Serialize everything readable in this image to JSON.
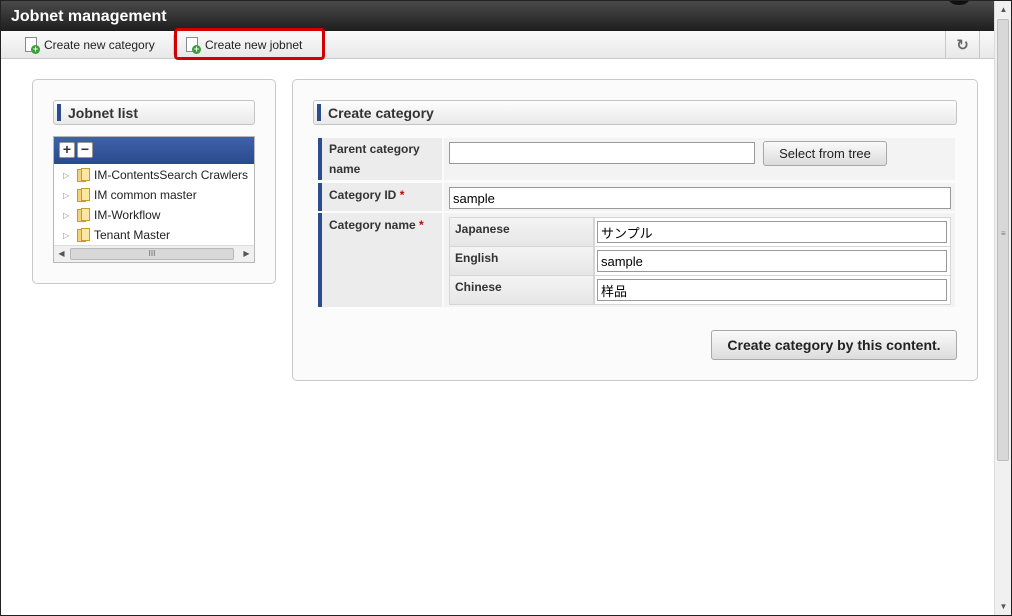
{
  "window": {
    "title": "Jobnet management"
  },
  "toolbar": {
    "create_category_label": "Create new category",
    "create_jobnet_label": "Create new jobnet",
    "refresh_icon": "refresh-icon"
  },
  "left_panel": {
    "title": "Jobnet list",
    "tree_items": [
      {
        "label": "IM-ContentsSearch Crawlers"
      },
      {
        "label": "IM common master"
      },
      {
        "label": "IM-Workflow"
      },
      {
        "label": "Tenant Master"
      }
    ],
    "hscroll_grip": "III"
  },
  "form": {
    "title": "Create category",
    "parent_category_label": "Parent category name",
    "parent_category_value": "",
    "select_from_tree_label": "Select from tree",
    "category_id_label": "Category ID",
    "category_id_value": "sample",
    "category_name_label": "Category name",
    "required_mark": "*",
    "languages": [
      {
        "label": "Japanese",
        "value": "サンプル"
      },
      {
        "label": "English",
        "value": "sample"
      },
      {
        "label": "Chinese",
        "value": "样品"
      }
    ],
    "submit_label": "Create category by this content."
  },
  "colors": {
    "accent": "#2d4c8c",
    "highlight": "#d40000",
    "titlebar": "#2a2a2a"
  }
}
